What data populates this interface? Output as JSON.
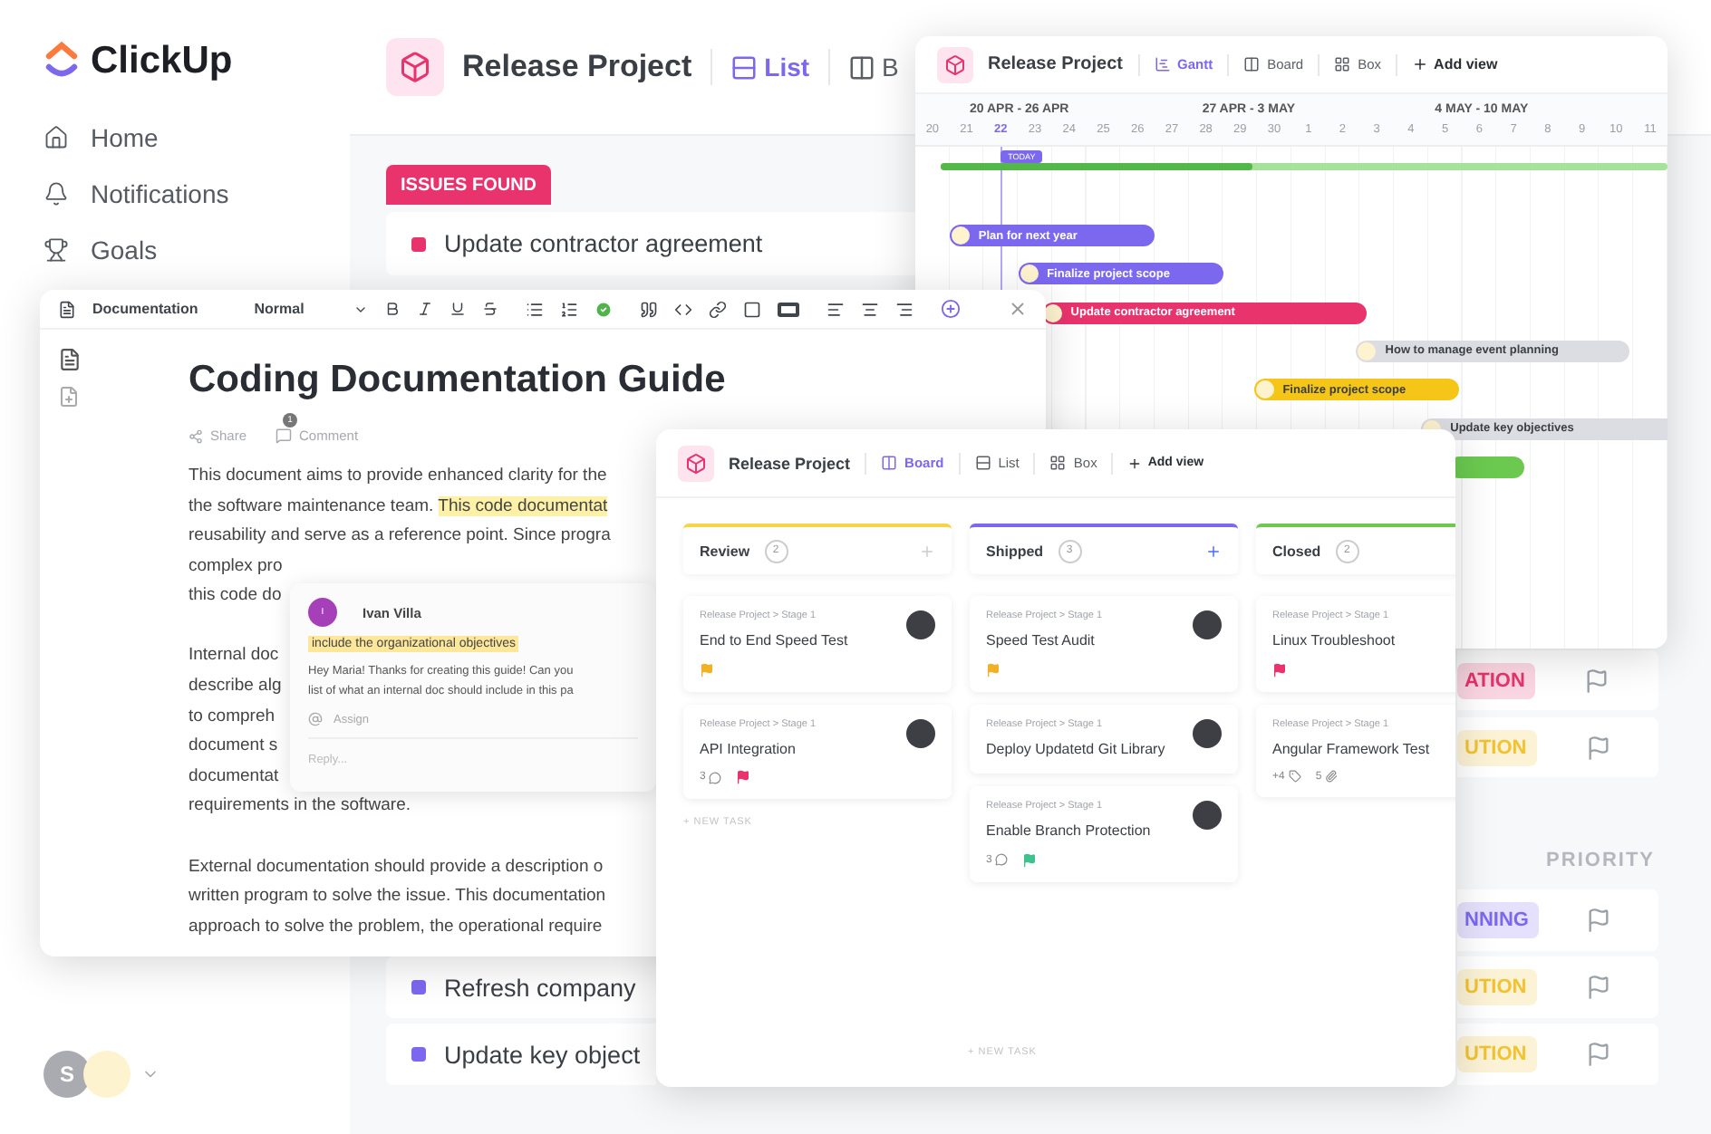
{
  "sidebar": {
    "logo": "ClickUp",
    "items": [
      {
        "label": "Home",
        "selected": false
      },
      {
        "label": "Notifications",
        "selected": false
      },
      {
        "label": "Goals",
        "selected": false
      }
    ],
    "avatar": "S"
  },
  "list_view": {
    "project": "Release Project",
    "tabs": [
      {
        "label": "List",
        "selected": true
      },
      {
        "label": "B",
        "selected": false
      }
    ],
    "group": {
      "label": "ISSUES FOUND",
      "color": "#e8336d",
      "rows": [
        {
          "task": "Update contractor agreement",
          "color": "#e8336d"
        }
      ]
    },
    "rows_top": [
      {
        "status": {
          "label": "ATION",
          "color": "#e8336d"
        }
      },
      {
        "status": {
          "label": "UTION",
          "color": "#f2c230"
        }
      }
    ],
    "priority_header": "PRIORITY",
    "rows_bottom": [
      {
        "status": {
          "label": "NNING",
          "color": "#7b68ee"
        }
      },
      {
        "task": "Refresh company",
        "color": "#7b68ee",
        "status": {
          "label": "UTION",
          "color": "#f2c230"
        }
      },
      {
        "task": "Update key object",
        "color": "#7b68ee",
        "status": {
          "label": "UTION",
          "color": "#f2c230"
        }
      }
    ]
  },
  "gantt": {
    "project": "Release Project",
    "tabs": [
      {
        "label": "Gantt",
        "kind": "gantt",
        "selected": true
      },
      {
        "label": "Board",
        "kind": "board",
        "selected": false
      },
      {
        "label": "Box",
        "kind": "box",
        "selected": false
      }
    ],
    "add_view": "Add view",
    "weeks": [
      "20 APR - 26 APR",
      "27 APR - 3 MAY",
      "4 MAY - 10 MAY"
    ],
    "days": [
      {
        "label": "20",
        "today": false
      },
      {
        "label": "21",
        "today": false
      },
      {
        "label": "22",
        "today": true
      },
      {
        "label": "23",
        "today": false
      },
      {
        "label": "24",
        "today": false
      },
      {
        "label": "25",
        "today": false
      },
      {
        "label": "26",
        "today": false
      },
      {
        "label": "27",
        "today": false
      },
      {
        "label": "28",
        "today": false
      },
      {
        "label": "29",
        "today": false
      },
      {
        "label": "30",
        "today": false
      },
      {
        "label": "1",
        "today": false
      },
      {
        "label": "2",
        "today": false
      },
      {
        "label": "3",
        "today": false
      },
      {
        "label": "4",
        "today": false
      },
      {
        "label": "5",
        "today": false
      },
      {
        "label": "6",
        "today": false
      },
      {
        "label": "7",
        "today": false
      },
      {
        "label": "8",
        "today": false
      },
      {
        "label": "9",
        "today": false
      },
      {
        "label": "10",
        "today": false
      },
      {
        "label": "11",
        "today": false
      }
    ],
    "today_label": "TODAY",
    "progress": {
      "level": 0.43
    },
    "bars": [
      {
        "label": "Plan for next year",
        "color": "#7b68ee"
      },
      {
        "label": "Finalize project scope",
        "color": "#7b68ee"
      },
      {
        "label": "Update contractor agreement",
        "color": "#e8336d"
      },
      {
        "label": "How to manage event planning",
        "color": "#dcdde2"
      },
      {
        "label": "Finalize project scope",
        "color": "#f5c518"
      },
      {
        "label": "Update key objectives",
        "color": "#dcdde2"
      },
      {
        "color": "#6bc950"
      }
    ]
  },
  "document": {
    "toolbar_title": "Documentation",
    "style": "Normal",
    "title": "Coding Documentation Guide",
    "share": "Share",
    "comment": "Comment",
    "comment_count": "1",
    "paragraphs": [
      [
        [
          {
            "text": "This document aims to provide enhanced clarity for the",
            "highlighted": false
          }
        ],
        [
          {
            "text": "the software maintenance team. ",
            "highlighted": false
          },
          {
            "text": "This code documentat",
            "highlighted": true
          }
        ],
        [
          {
            "text": "reusability and serve as a reference point. Since progra",
            "highlighted": false
          }
        ],
        [
          {
            "text": "complex pro",
            "highlighted": false
          }
        ],
        [
          {
            "text": "this code do",
            "highlighted": false
          }
        ]
      ],
      [
        [
          {
            "text": "Internal doc",
            "highlighted": false
          }
        ],
        [
          {
            "text": "describe alg",
            "highlighted": false
          }
        ],
        [
          {
            "text": "to compreh",
            "highlighted": false
          }
        ],
        [
          {
            "text": "document s",
            "highlighted": false
          }
        ],
        [
          {
            "text": "documentat",
            "highlighted": false
          }
        ],
        [
          {
            "text": "requirements in the software.",
            "highlighted": false
          }
        ]
      ],
      [
        [
          {
            "text": "External documentation should provide a description o",
            "highlighted": false
          }
        ],
        [
          {
            "text": "written program to solve the issue. This documentation",
            "highlighted": false
          }
        ],
        [
          {
            "text": "approach to solve the problem, the operational require",
            "highlighted": false
          }
        ]
      ]
    ],
    "comment_card": {
      "author": "Ivan Villa",
      "avatar": "I",
      "quote": "include the organizational objectives",
      "lines": [
        "Hey Maria! Thanks for creating this guide! Can you",
        "list of what an internal doc should include in this pa"
      ],
      "assign": "Assign",
      "reply_placeholder": "Reply..."
    }
  },
  "board": {
    "project": "Release Project",
    "tabs": [
      {
        "label": "Board",
        "kind": "board",
        "selected": true
      },
      {
        "label": "List",
        "kind": "list",
        "selected": false
      },
      {
        "label": "Box",
        "kind": "box",
        "selected": false
      }
    ],
    "add_view": "Add view",
    "new_task": "+ NEW TASK",
    "columns": [
      {
        "title": "Review",
        "count": "2",
        "color": "#f5d547",
        "new_task": "+ NEW TASK",
        "cards": [
          {
            "path": "Release Project > Stage 1",
            "title": "End to End Speed Test",
            "flag": {
              "color": "#f2b124"
            }
          },
          {
            "path": "Release Project > Stage 1",
            "title": "API Integration",
            "comments": "3",
            "flag": {
              "color": "#e8336d"
            }
          }
        ]
      },
      {
        "title": "Shipped",
        "count": "3",
        "color": "#7b68ee",
        "cards": [
          {
            "path": "Release Project > Stage 1",
            "title": "Speed Test Audit",
            "flag": {
              "color": "#f2b124"
            }
          },
          {
            "path": "Release Project > Stage 1",
            "title": "Deploy Updatetd Git Library"
          },
          {
            "path": "Release Project > Stage 1",
            "title": "Enable Branch Protection",
            "comments": "3",
            "flag": {
              "color": "#3ec28f"
            }
          }
        ]
      },
      {
        "title": "Closed",
        "count": "2",
        "color": "#6bc950",
        "cards": [
          {
            "path": "Release Project > Stage 1",
            "title": "Linux Troubleshoot",
            "flag": {
              "color": "#e8336d"
            }
          },
          {
            "path": "Release Project > Stage 1",
            "title": "Angular Framework Test",
            "tags": "+4",
            "attachments": "5"
          }
        ]
      }
    ]
  }
}
